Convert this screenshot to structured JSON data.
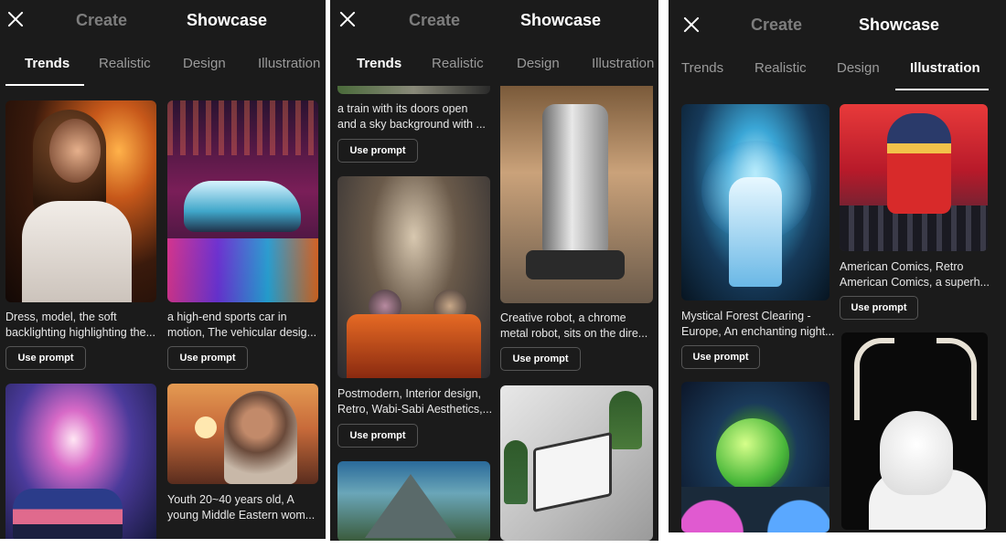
{
  "header": {
    "create_label": "Create",
    "showcase_label": "Showcase"
  },
  "tabs": [
    "Trends",
    "Realistic",
    "Design",
    "Illustration"
  ],
  "use_prompt_label": "Use prompt",
  "screen1": {
    "active_tab": "Trends",
    "cards": [
      {
        "caption_line1": "Dress, model, the soft",
        "caption_line2": "backlighting highlighting the..."
      },
      {
        "caption_line1": "a high-end sports car in",
        "caption_line2": "motion, The vehicular desig..."
      },
      {
        "caption_line1": "",
        "caption_line2": ""
      },
      {
        "caption_line1": "Youth 20~40 years old, A",
        "caption_line2": "young Middle Eastern wom..."
      }
    ]
  },
  "screen2": {
    "active_tab": "Trends",
    "cards": [
      {
        "caption_line1": "a train with its doors open",
        "caption_line2": "and a sky background with ..."
      },
      {
        "caption_line1": "Postmodern, Interior design,",
        "caption_line2": "Retro, Wabi-Sabi Aesthetics,..."
      },
      {
        "caption_line1": "Creative robot, a chrome",
        "caption_line2": "metal robot, sits on the dire..."
      }
    ]
  },
  "screen3": {
    "active_tab": "Illustration",
    "cards": [
      {
        "caption_line1": "Mystical Forest Clearing -",
        "caption_line2": "Europe, An enchanting night..."
      },
      {
        "caption_line1": "American Comics, Retro",
        "caption_line2": "American Comics, a superh..."
      }
    ]
  }
}
